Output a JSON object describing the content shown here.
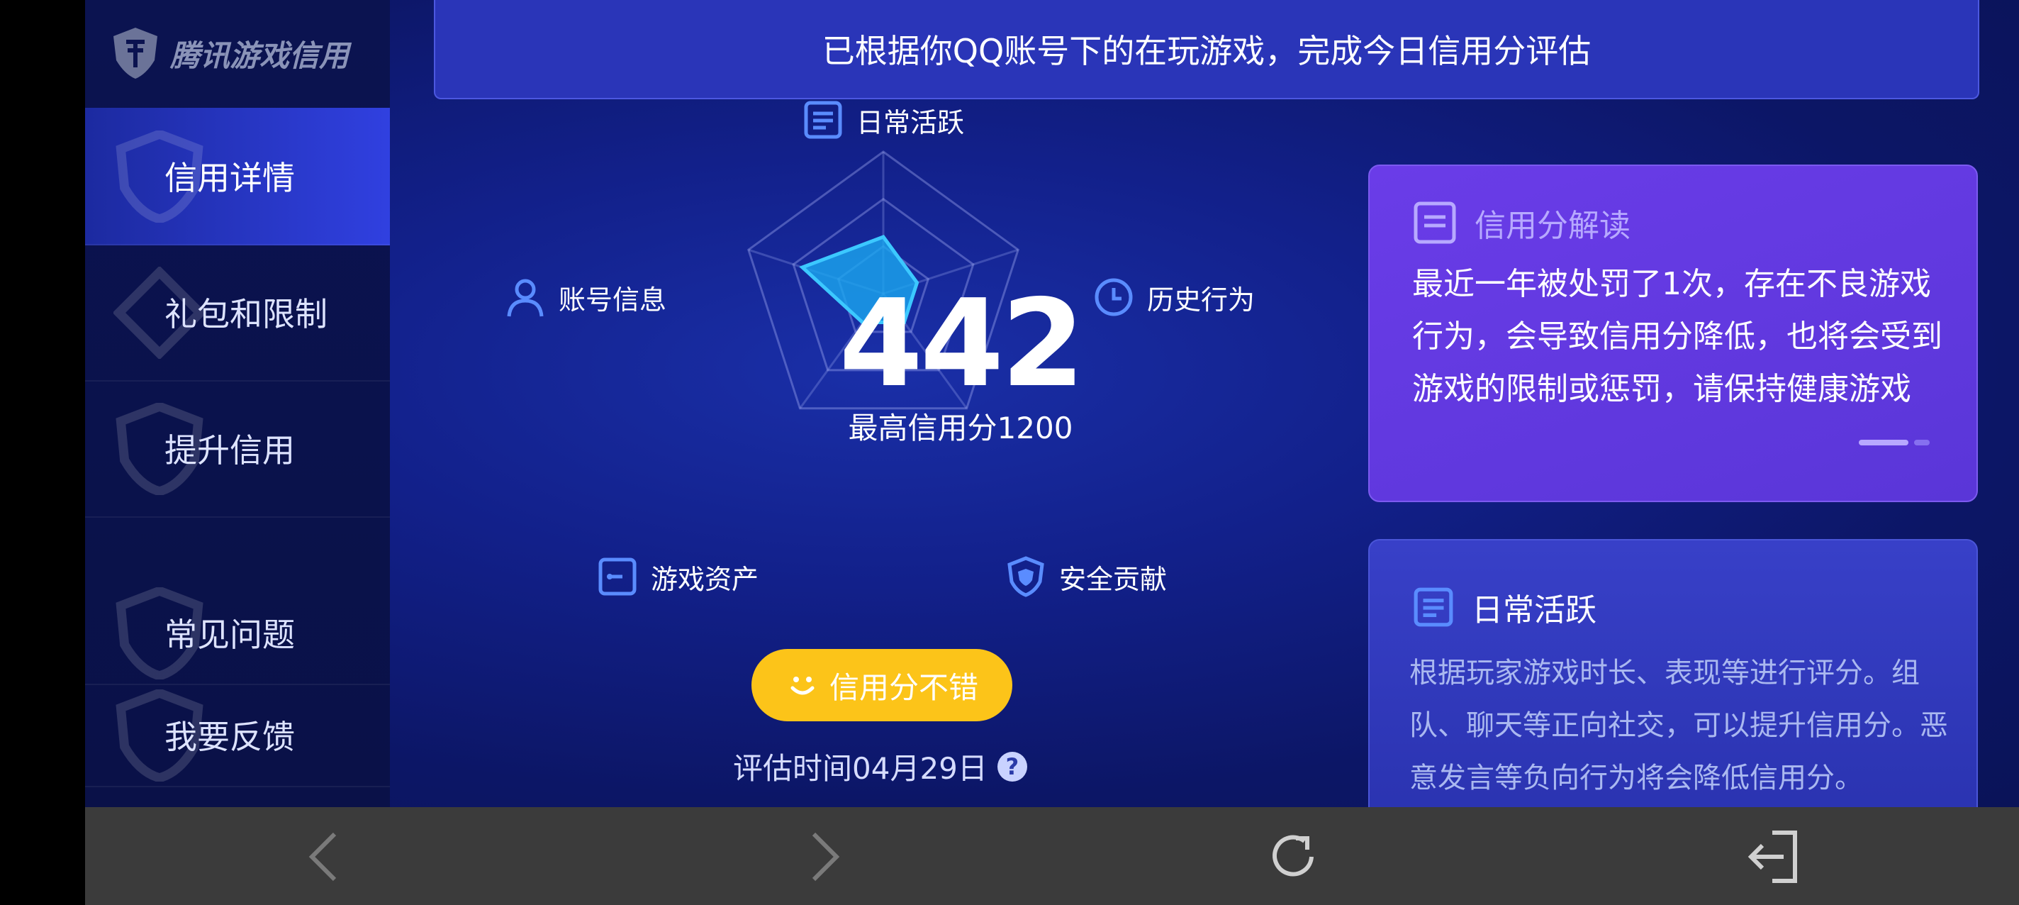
{
  "app": {
    "logo_text": "腾讯游戏信用"
  },
  "sidebar": {
    "items": [
      {
        "label": "信用详情",
        "active": true
      },
      {
        "label": "礼包和限制"
      },
      {
        "label": "提升信用"
      },
      {
        "label": "常见问题"
      },
      {
        "label": "我要反馈"
      }
    ]
  },
  "banner": {
    "text": "已根据你QQ账号下的在玩游戏，完成今日信用分评估"
  },
  "radar": {
    "axes": [
      "日常活跃",
      "历史行为",
      "安全贡献",
      "游戏资产",
      "账号信息"
    ],
    "icons": [
      "list-icon",
      "clock-icon",
      "shield-icon",
      "wallet-icon",
      "user-icon"
    ],
    "levels": [
      0.4,
      0.25,
      0.25,
      0.25,
      0.6
    ],
    "score": "442",
    "max_text": "最高信用分1200",
    "status": "信用分不错",
    "eval_time": "评估时间04月29日",
    "help": "?"
  },
  "card_interpret": {
    "title": "信用分解读",
    "text": "最近一年被处罚了1次，存在不良游戏行为，会导致信用分降低，也将会受到游戏的限制或惩罚，请保持健康游戏"
  },
  "card_daily": {
    "title": "日常活跃",
    "text": "根据玩家游戏时长、表现等进行评分。组队、聊天等正向社交，可以提升信用分。恶意发言等负向行为将会降低信用分。"
  },
  "colors": {
    "accent_yellow": "#fcc419",
    "card_purple": "#6a3ce8",
    "radar_fill": "#1aa8f0"
  }
}
